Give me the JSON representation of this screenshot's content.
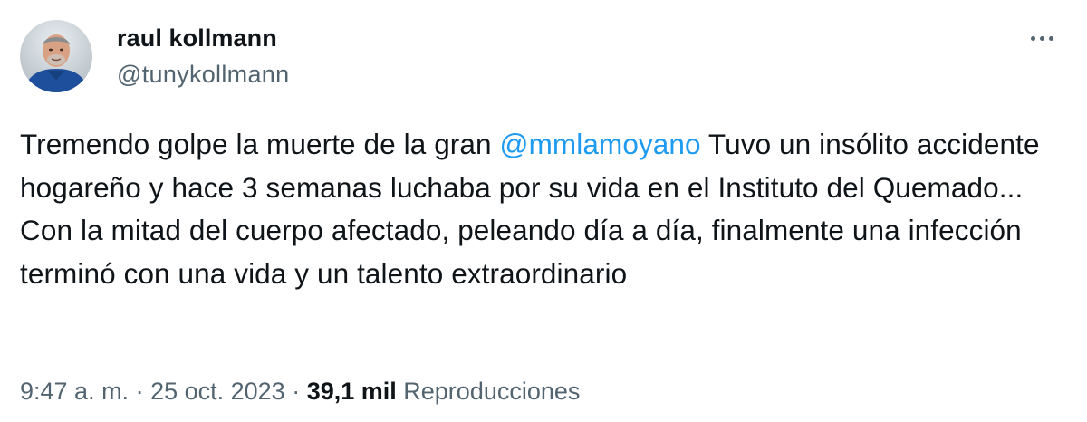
{
  "author": {
    "display_name": "raul kollmann",
    "handle": "@tunykollmann"
  },
  "tweet": {
    "text_before": "Tremendo golpe la muerte de la gran ",
    "mention": "@mmlamoyano",
    "text_after": " Tuvo un insólito accidente hogareño y hace 3 semanas luchaba por su vida en el Instituto del Quemado... Con la mitad del cuerpo afectado, peleando día a día, finalmente una infección terminó con una vida y un talento extraordinario"
  },
  "meta": {
    "time": "9:47 a. m.",
    "separator": " · ",
    "date": "25 oct. 2023",
    "views_count": "39,1 mil",
    "views_label": "Reproducciones"
  },
  "icons": {
    "more": "more-options-icon",
    "avatar": "avatar"
  },
  "colors": {
    "text": "#0f1419",
    "secondary": "#536471",
    "link": "#1d9bf0"
  }
}
